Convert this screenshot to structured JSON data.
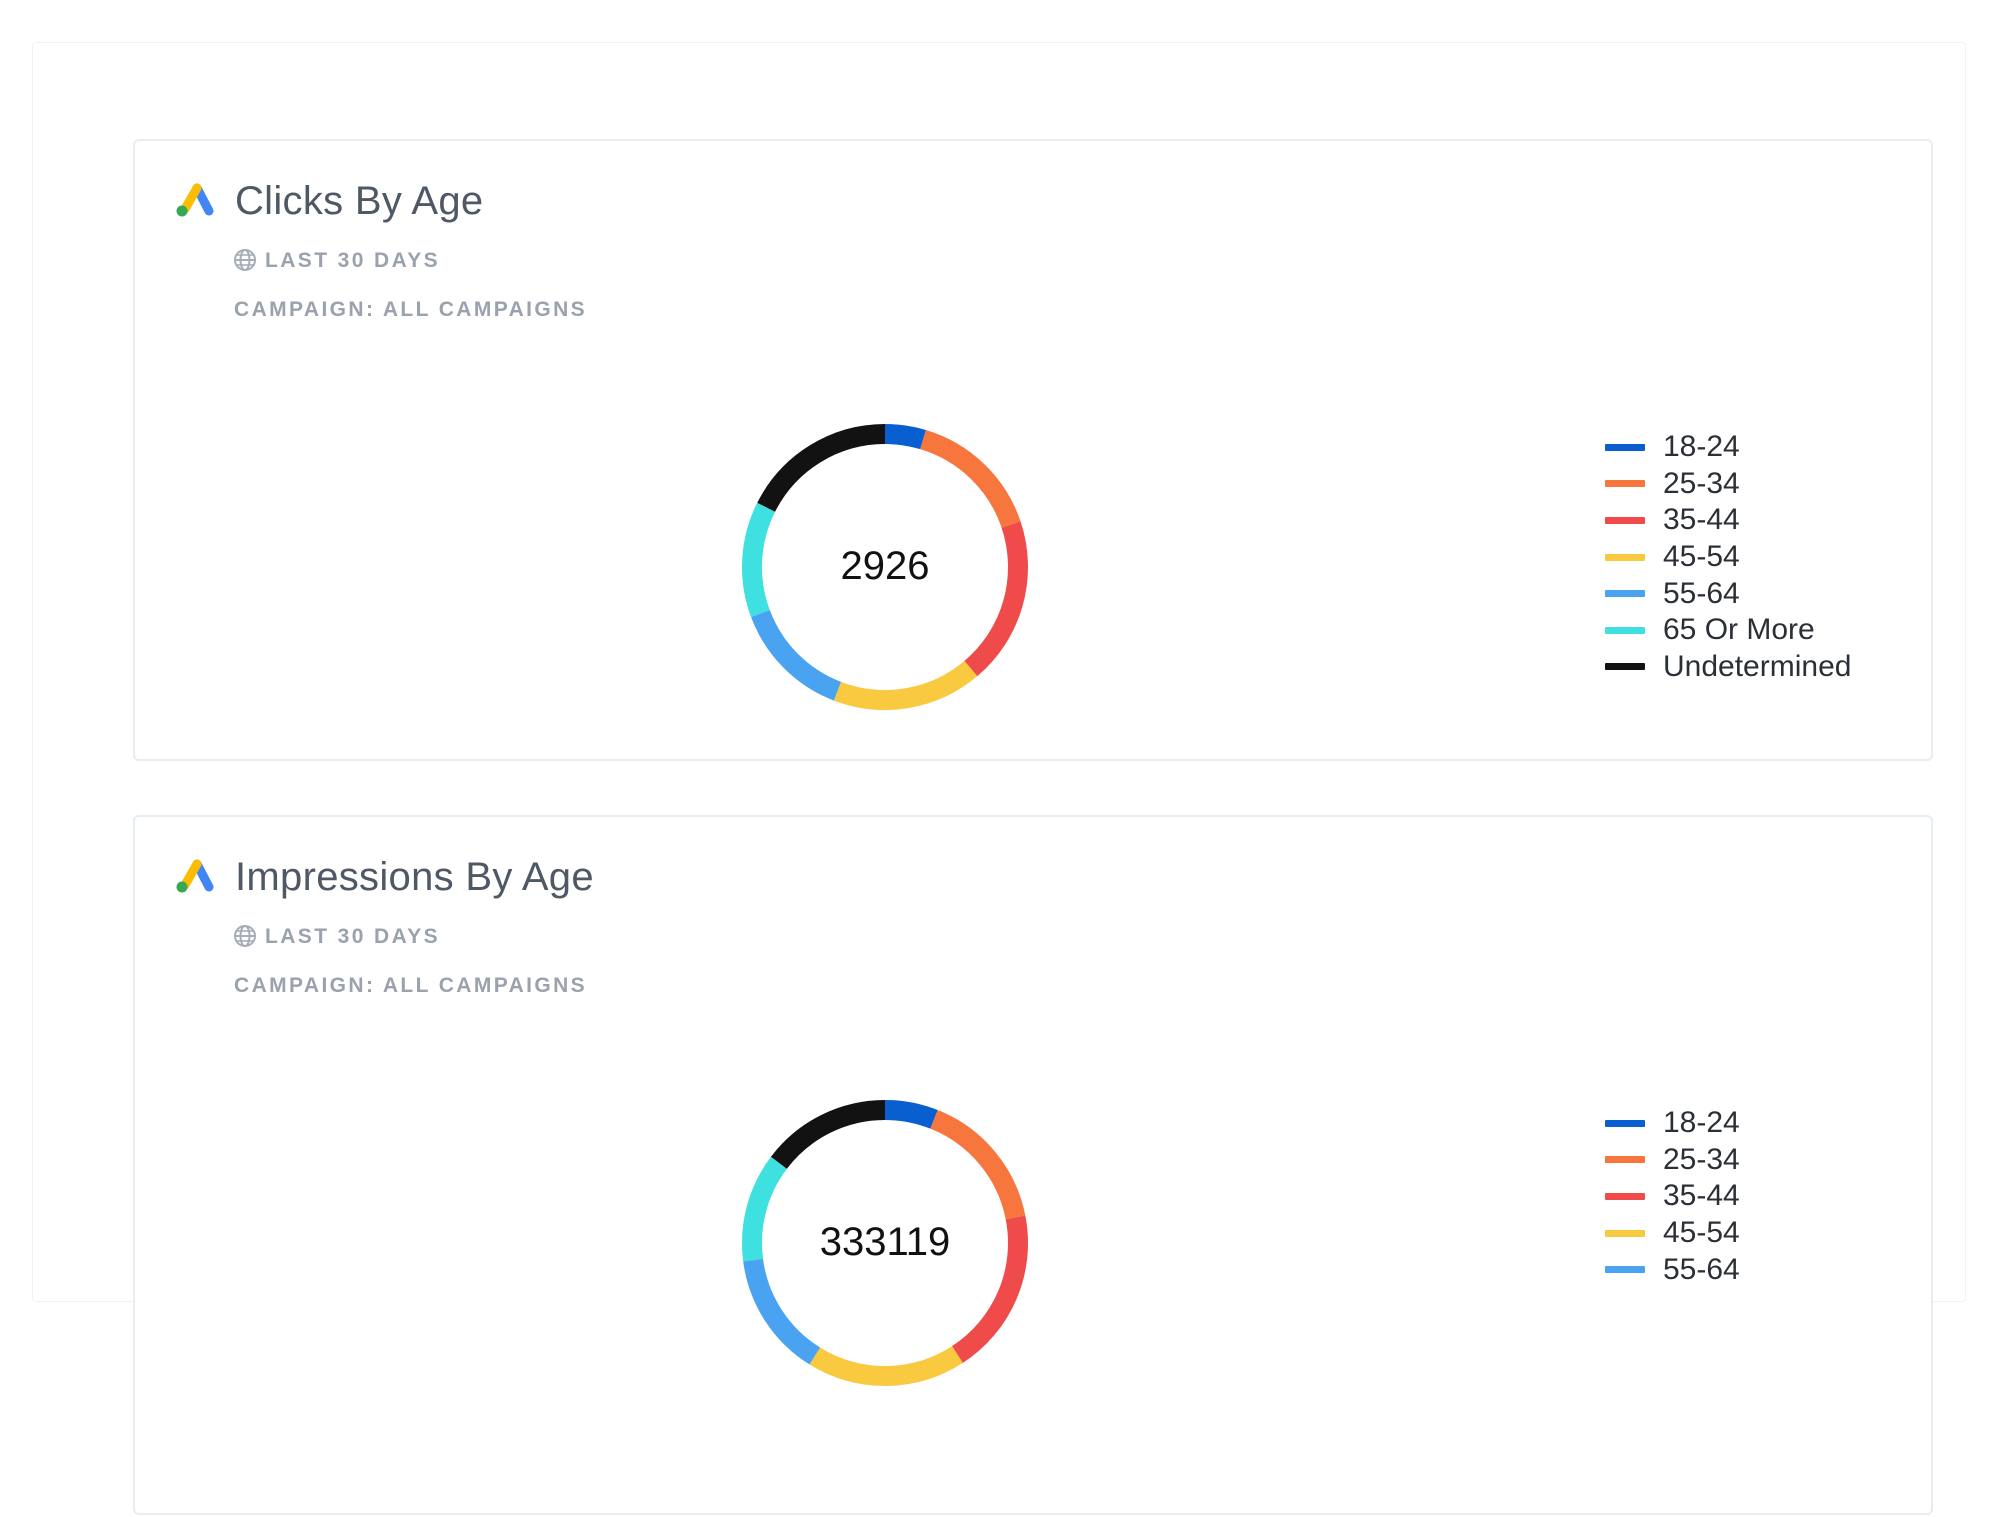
{
  "palette": {
    "18-24": "#0a5fd0",
    "25-34": "#f6763e",
    "35-44": "#ef4b4b",
    "45-54": "#f9c940",
    "55-64": "#4aa3f0",
    "65 Or More": "#3ee0e0",
    "Undetermined": "#121212"
  },
  "cards": [
    {
      "title": "Clicks By Age",
      "date_range": "LAST 30 DAYS",
      "campaign": "CAMPAIGN: ALL CAMPAIGNS",
      "legend": [
        "18-24",
        "25-34",
        "35-44",
        "45-54",
        "55-64",
        "65 Or More",
        "Undetermined"
      ]
    },
    {
      "title": "Impressions By Age",
      "date_range": "LAST 30 DAYS",
      "campaign": "CAMPAIGN: ALL CAMPAIGNS",
      "legend": [
        "18-24",
        "25-34",
        "35-44",
        "45-54",
        "55-64"
      ]
    }
  ],
  "chart_data": [
    {
      "type": "pie",
      "title": "Clicks By Age",
      "center_label": "2926",
      "categories": [
        "18-24",
        "25-34",
        "35-44",
        "45-54",
        "55-64",
        "65 Or More",
        "Undetermined"
      ],
      "values": [
        135,
        445,
        556,
        497,
        395,
        383,
        515
      ],
      "legend_position": "right"
    },
    {
      "type": "pie",
      "title": "Impressions By Age",
      "center_label": "333119",
      "categories": [
        "18-24",
        "25-34",
        "35-44",
        "45-54",
        "55-64",
        "65 Or More",
        "Undetermined"
      ],
      "values": [
        20000,
        53000,
        63000,
        60000,
        47000,
        41119,
        49000
      ],
      "legend_position": "right"
    }
  ]
}
